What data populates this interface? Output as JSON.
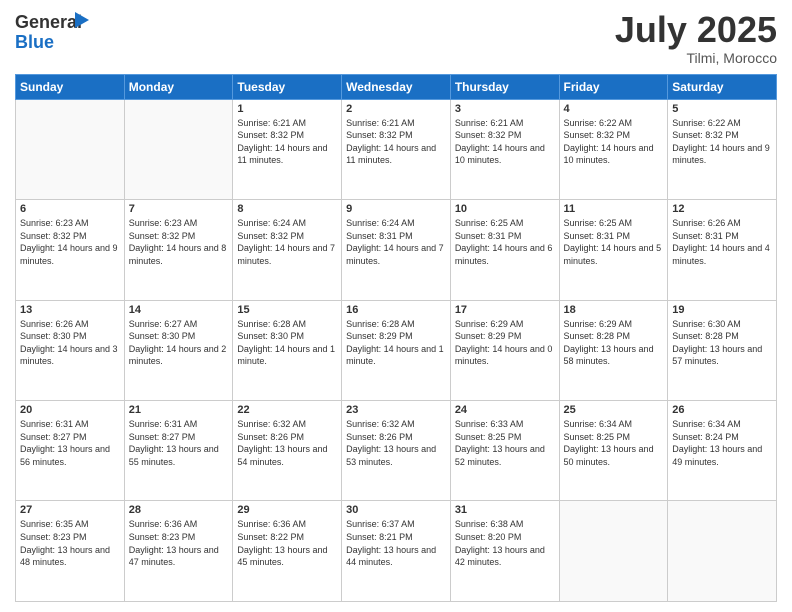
{
  "logo": {
    "line1": "General",
    "line2": "Blue"
  },
  "title": "July 2025",
  "location": "Tilmi, Morocco",
  "weekdays": [
    "Sunday",
    "Monday",
    "Tuesday",
    "Wednesday",
    "Thursday",
    "Friday",
    "Saturday"
  ],
  "weeks": [
    [
      {
        "day": "",
        "detail": ""
      },
      {
        "day": "",
        "detail": ""
      },
      {
        "day": "1",
        "detail": "Sunrise: 6:21 AM\nSunset: 8:32 PM\nDaylight: 14 hours and 11 minutes."
      },
      {
        "day": "2",
        "detail": "Sunrise: 6:21 AM\nSunset: 8:32 PM\nDaylight: 14 hours and 11 minutes."
      },
      {
        "day": "3",
        "detail": "Sunrise: 6:21 AM\nSunset: 8:32 PM\nDaylight: 14 hours and 10 minutes."
      },
      {
        "day": "4",
        "detail": "Sunrise: 6:22 AM\nSunset: 8:32 PM\nDaylight: 14 hours and 10 minutes."
      },
      {
        "day": "5",
        "detail": "Sunrise: 6:22 AM\nSunset: 8:32 PM\nDaylight: 14 hours and 9 minutes."
      }
    ],
    [
      {
        "day": "6",
        "detail": "Sunrise: 6:23 AM\nSunset: 8:32 PM\nDaylight: 14 hours and 9 minutes."
      },
      {
        "day": "7",
        "detail": "Sunrise: 6:23 AM\nSunset: 8:32 PM\nDaylight: 14 hours and 8 minutes."
      },
      {
        "day": "8",
        "detail": "Sunrise: 6:24 AM\nSunset: 8:32 PM\nDaylight: 14 hours and 7 minutes."
      },
      {
        "day": "9",
        "detail": "Sunrise: 6:24 AM\nSunset: 8:31 PM\nDaylight: 14 hours and 7 minutes."
      },
      {
        "day": "10",
        "detail": "Sunrise: 6:25 AM\nSunset: 8:31 PM\nDaylight: 14 hours and 6 minutes."
      },
      {
        "day": "11",
        "detail": "Sunrise: 6:25 AM\nSunset: 8:31 PM\nDaylight: 14 hours and 5 minutes."
      },
      {
        "day": "12",
        "detail": "Sunrise: 6:26 AM\nSunset: 8:31 PM\nDaylight: 14 hours and 4 minutes."
      }
    ],
    [
      {
        "day": "13",
        "detail": "Sunrise: 6:26 AM\nSunset: 8:30 PM\nDaylight: 14 hours and 3 minutes."
      },
      {
        "day": "14",
        "detail": "Sunrise: 6:27 AM\nSunset: 8:30 PM\nDaylight: 14 hours and 2 minutes."
      },
      {
        "day": "15",
        "detail": "Sunrise: 6:28 AM\nSunset: 8:30 PM\nDaylight: 14 hours and 1 minute."
      },
      {
        "day": "16",
        "detail": "Sunrise: 6:28 AM\nSunset: 8:29 PM\nDaylight: 14 hours and 1 minute."
      },
      {
        "day": "17",
        "detail": "Sunrise: 6:29 AM\nSunset: 8:29 PM\nDaylight: 14 hours and 0 minutes."
      },
      {
        "day": "18",
        "detail": "Sunrise: 6:29 AM\nSunset: 8:28 PM\nDaylight: 13 hours and 58 minutes."
      },
      {
        "day": "19",
        "detail": "Sunrise: 6:30 AM\nSunset: 8:28 PM\nDaylight: 13 hours and 57 minutes."
      }
    ],
    [
      {
        "day": "20",
        "detail": "Sunrise: 6:31 AM\nSunset: 8:27 PM\nDaylight: 13 hours and 56 minutes."
      },
      {
        "day": "21",
        "detail": "Sunrise: 6:31 AM\nSunset: 8:27 PM\nDaylight: 13 hours and 55 minutes."
      },
      {
        "day": "22",
        "detail": "Sunrise: 6:32 AM\nSunset: 8:26 PM\nDaylight: 13 hours and 54 minutes."
      },
      {
        "day": "23",
        "detail": "Sunrise: 6:32 AM\nSunset: 8:26 PM\nDaylight: 13 hours and 53 minutes."
      },
      {
        "day": "24",
        "detail": "Sunrise: 6:33 AM\nSunset: 8:25 PM\nDaylight: 13 hours and 52 minutes."
      },
      {
        "day": "25",
        "detail": "Sunrise: 6:34 AM\nSunset: 8:25 PM\nDaylight: 13 hours and 50 minutes."
      },
      {
        "day": "26",
        "detail": "Sunrise: 6:34 AM\nSunset: 8:24 PM\nDaylight: 13 hours and 49 minutes."
      }
    ],
    [
      {
        "day": "27",
        "detail": "Sunrise: 6:35 AM\nSunset: 8:23 PM\nDaylight: 13 hours and 48 minutes."
      },
      {
        "day": "28",
        "detail": "Sunrise: 6:36 AM\nSunset: 8:23 PM\nDaylight: 13 hours and 47 minutes."
      },
      {
        "day": "29",
        "detail": "Sunrise: 6:36 AM\nSunset: 8:22 PM\nDaylight: 13 hours and 45 minutes."
      },
      {
        "day": "30",
        "detail": "Sunrise: 6:37 AM\nSunset: 8:21 PM\nDaylight: 13 hours and 44 minutes."
      },
      {
        "day": "31",
        "detail": "Sunrise: 6:38 AM\nSunset: 8:20 PM\nDaylight: 13 hours and 42 minutes."
      },
      {
        "day": "",
        "detail": ""
      },
      {
        "day": "",
        "detail": ""
      }
    ]
  ]
}
